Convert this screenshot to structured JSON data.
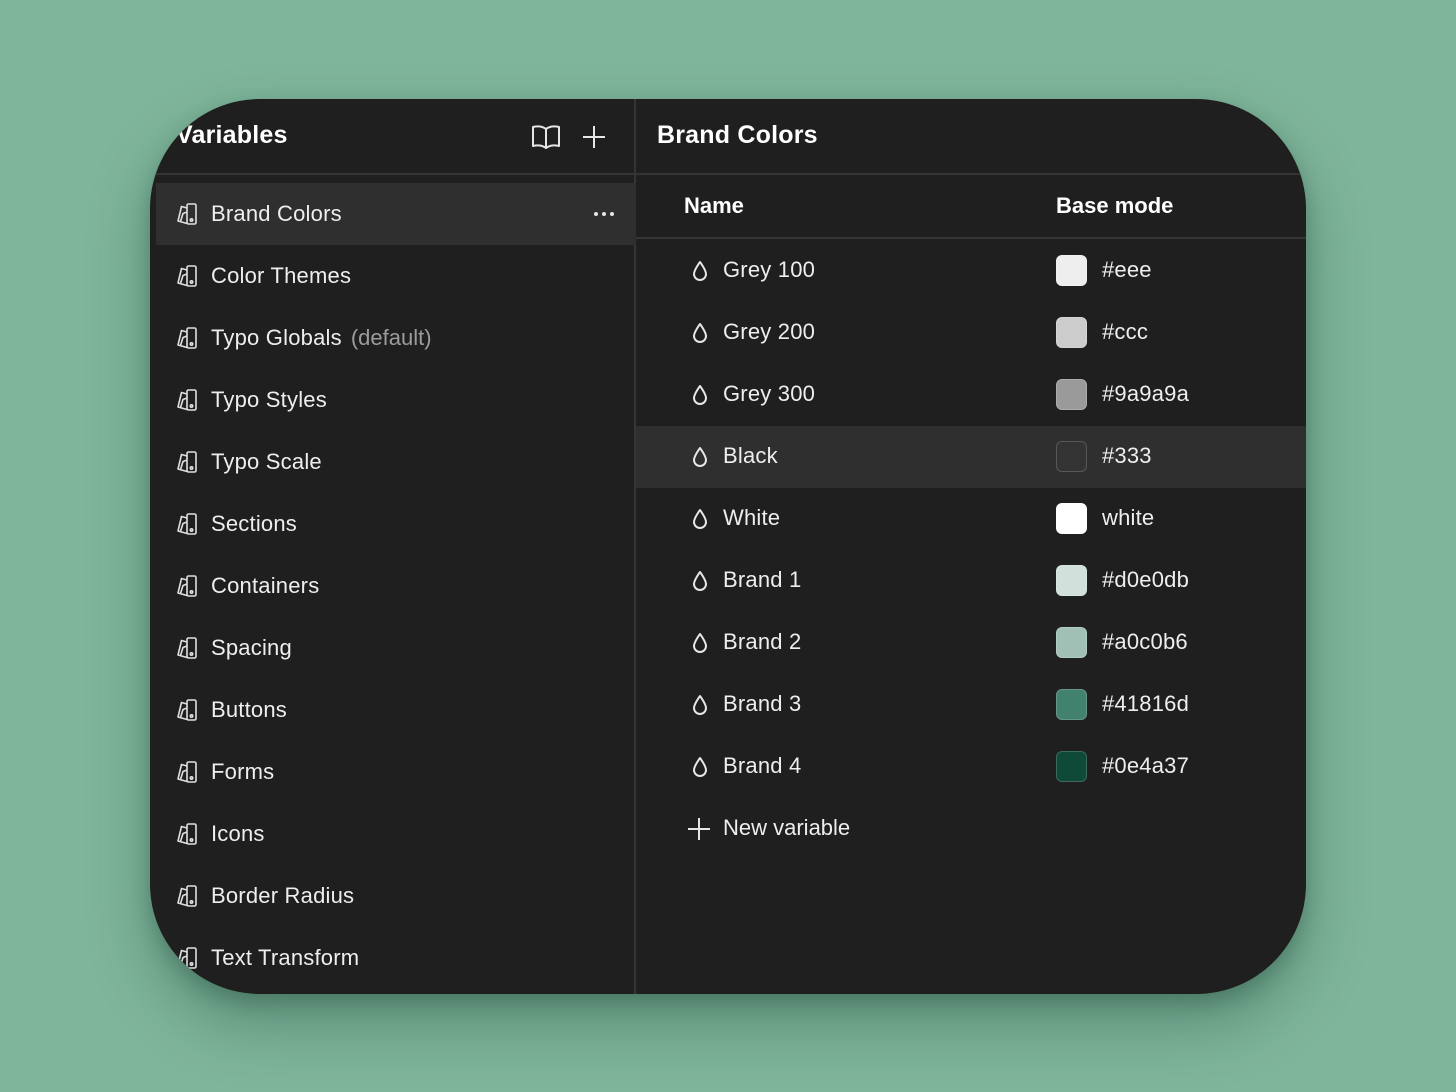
{
  "sidebar": {
    "title": "Variables",
    "header_icons": [
      "book-icon",
      "plus-icon"
    ],
    "items": [
      {
        "label": "Brand Colors",
        "suffix": "",
        "active": true
      },
      {
        "label": "Color Themes",
        "suffix": ""
      },
      {
        "label": "Typo Globals",
        "suffix": "(default)"
      },
      {
        "label": "Typo Styles",
        "suffix": ""
      },
      {
        "label": "Typo Scale",
        "suffix": ""
      },
      {
        "label": "Sections",
        "suffix": ""
      },
      {
        "label": "Containers",
        "suffix": ""
      },
      {
        "label": "Spacing",
        "suffix": ""
      },
      {
        "label": "Buttons",
        "suffix": ""
      },
      {
        "label": "Forms",
        "suffix": ""
      },
      {
        "label": "Icons",
        "suffix": ""
      },
      {
        "label": "Border Radius",
        "suffix": ""
      },
      {
        "label": "Text Transform",
        "suffix": ""
      }
    ],
    "item_icon": "collection-icon",
    "more_icon": "more-icon"
  },
  "main": {
    "title": "Brand Colors",
    "columns": {
      "name": "Name",
      "mode": "Base mode"
    },
    "variable_icon": "drop-icon",
    "variables": [
      {
        "name": "Grey 100",
        "value": "#eee",
        "color": "#eeeeee"
      },
      {
        "name": "Grey 200",
        "value": "#ccc",
        "color": "#cccccc"
      },
      {
        "name": "Grey 300",
        "value": "#9a9a9a",
        "color": "#9a9a9a"
      },
      {
        "name": "Black",
        "value": "#333",
        "color": "#333333",
        "active": true
      },
      {
        "name": "White",
        "value": "white",
        "color": "#ffffff"
      },
      {
        "name": "Brand 1",
        "value": "#d0e0db",
        "color": "#d0e0db"
      },
      {
        "name": "Brand 2",
        "value": "#a0c0b6",
        "color": "#a0c0b6"
      },
      {
        "name": "Brand 3",
        "value": "#41816d",
        "color": "#41816d"
      },
      {
        "name": "Brand 4",
        "value": "#0e4a37",
        "color": "#0e4a37"
      }
    ],
    "new_variable_label": "New variable"
  },
  "colors": {
    "background": "#7fb59b",
    "panel": "#1f1f1f",
    "active_row": "#2f2f2f",
    "divider": "#353535"
  }
}
